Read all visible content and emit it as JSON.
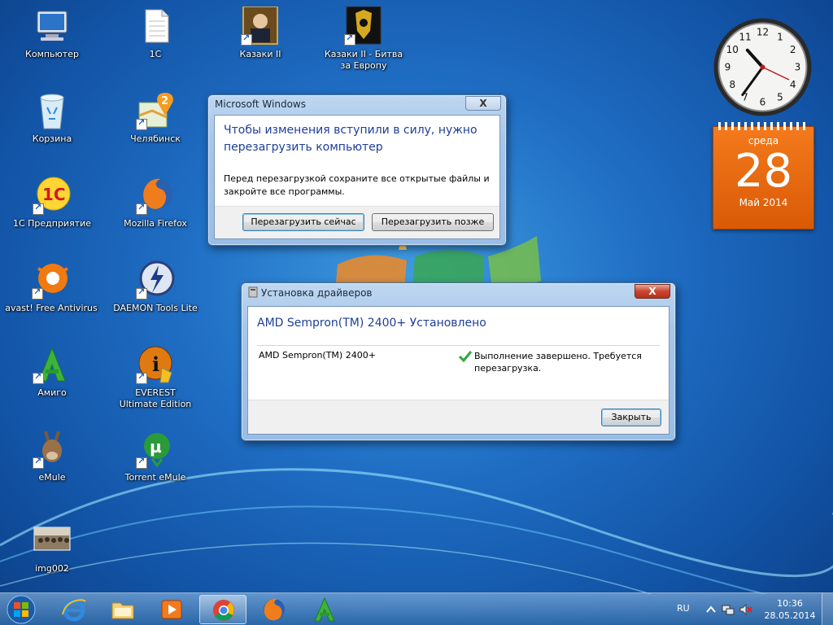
{
  "desktop_icons": [
    {
      "label": "Компьютер",
      "icon": "computer-icon"
    },
    {
      "label": "1С",
      "icon": "document-icon"
    },
    {
      "label": "Казаки II",
      "icon": "cossacks-icon"
    },
    {
      "label": "Казаки II - Битва за Европу",
      "icon": "cossacks-europe-icon"
    },
    {
      "label": "Корзина",
      "icon": "recycle-bin-icon"
    },
    {
      "label": "Челябинск",
      "icon": "map-icon"
    },
    {
      "label": "1С Предприятие",
      "icon": "1c-icon"
    },
    {
      "label": "Mozilla Firefox",
      "icon": "firefox-icon"
    },
    {
      "label": "avast! Free Antivirus",
      "icon": "avast-icon"
    },
    {
      "label": "DAEMON Tools Lite",
      "icon": "daemon-tools-icon"
    },
    {
      "label": "Амиго",
      "icon": "amigo-icon"
    },
    {
      "label": "EVEREST Ultimate Edition",
      "icon": "everest-icon"
    },
    {
      "label": "eMule",
      "icon": "emule-icon"
    },
    {
      "label": "Torrent eMule",
      "icon": "utorrent-icon"
    },
    {
      "label": "img002",
      "icon": "image-thumbnail-icon"
    }
  ],
  "gadgets": {
    "clock": {
      "hour": 10,
      "minute": 36
    },
    "calendar": {
      "weekday": "среда",
      "day": "28",
      "month_year": "Май 2014"
    }
  },
  "restart_dialog": {
    "title": "Microsoft Windows",
    "close": "X",
    "heading": "Чтобы изменения вступили в силу, нужно перезагрузить компьютер",
    "message": "Перед перезагрузкой сохраните все открытые файлы и закройте все программы.",
    "restart_now": "Перезагрузить сейчас",
    "restart_later": "Перезагрузить позже"
  },
  "driver_dialog": {
    "title": "Установка драйверов",
    "close": "X",
    "heading": "AMD Sempron(TM) 2400+ Установлено",
    "device": "AMD Sempron(TM) 2400+",
    "status": "Выполнение завершено. Требуется перезагрузка.",
    "close_button": "Закрыть"
  },
  "taskbar": {
    "pinned": [
      {
        "name": "internet-explorer"
      },
      {
        "name": "explorer"
      },
      {
        "name": "media-player"
      },
      {
        "name": "chrome",
        "active": true
      },
      {
        "name": "firefox"
      },
      {
        "name": "amigo"
      }
    ],
    "language": "RU",
    "time": "10:36",
    "date": "28.05.2014"
  },
  "colors": {
    "accent": "#1f5fbf",
    "dialog_heading": "#1e3f9a",
    "calendar": "#e8690f"
  }
}
